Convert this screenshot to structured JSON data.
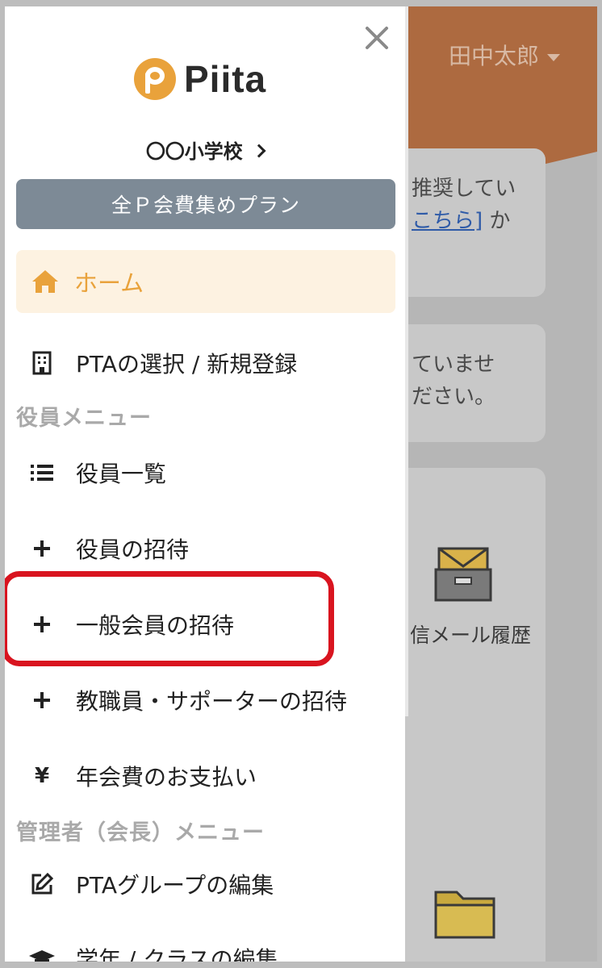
{
  "app": {
    "logo_text": "Piita",
    "brand_color": "#e9a23b"
  },
  "background_page": {
    "user_menu_label": "田中太郎",
    "card1_line1": "推奨してい",
    "card1_link": "こちら]",
    "card1_line2_suffix": " か",
    "card2_line1": "ていませ",
    "card2_line2": "ださい。",
    "tile_mail_label": "信メール履歴",
    "tile_mail_icon": "mail-inbox-icon",
    "tile_folder_icon": "folder-icon"
  },
  "drawer": {
    "close_icon": "close-icon",
    "school_label": "〇〇小学校",
    "plan_button_label": "全Ｐ会費集めプラン",
    "home": {
      "label": "ホーム",
      "icon": "home-icon",
      "active": true
    },
    "items_top": [
      {
        "label": "PTAの選択 / 新規登録",
        "icon": "building-icon"
      }
    ],
    "section_officer": "役員メニュー",
    "items_officer": [
      {
        "label": "役員一覧",
        "icon": "list-icon"
      },
      {
        "label": "役員の招待",
        "icon": "plus-icon"
      },
      {
        "label": "一般会員の招待",
        "icon": "plus-icon",
        "highlighted": true
      },
      {
        "label": "教職員・サポーターの招待",
        "icon": "plus-icon"
      },
      {
        "label": "年会費のお支払い",
        "icon": "yen-icon",
        "glyph": "¥"
      }
    ],
    "section_admin": "管理者（会長）メニュー",
    "items_admin": [
      {
        "label": "PTAグループの編集",
        "icon": "edit-icon"
      },
      {
        "label": "学年 / クラスの編集",
        "icon": "graduation-cap-icon"
      }
    ]
  },
  "colors": {
    "highlight_border": "#d9141f",
    "plan_button_bg": "#7d8a96",
    "home_active_bg": "#fdf2e1"
  }
}
